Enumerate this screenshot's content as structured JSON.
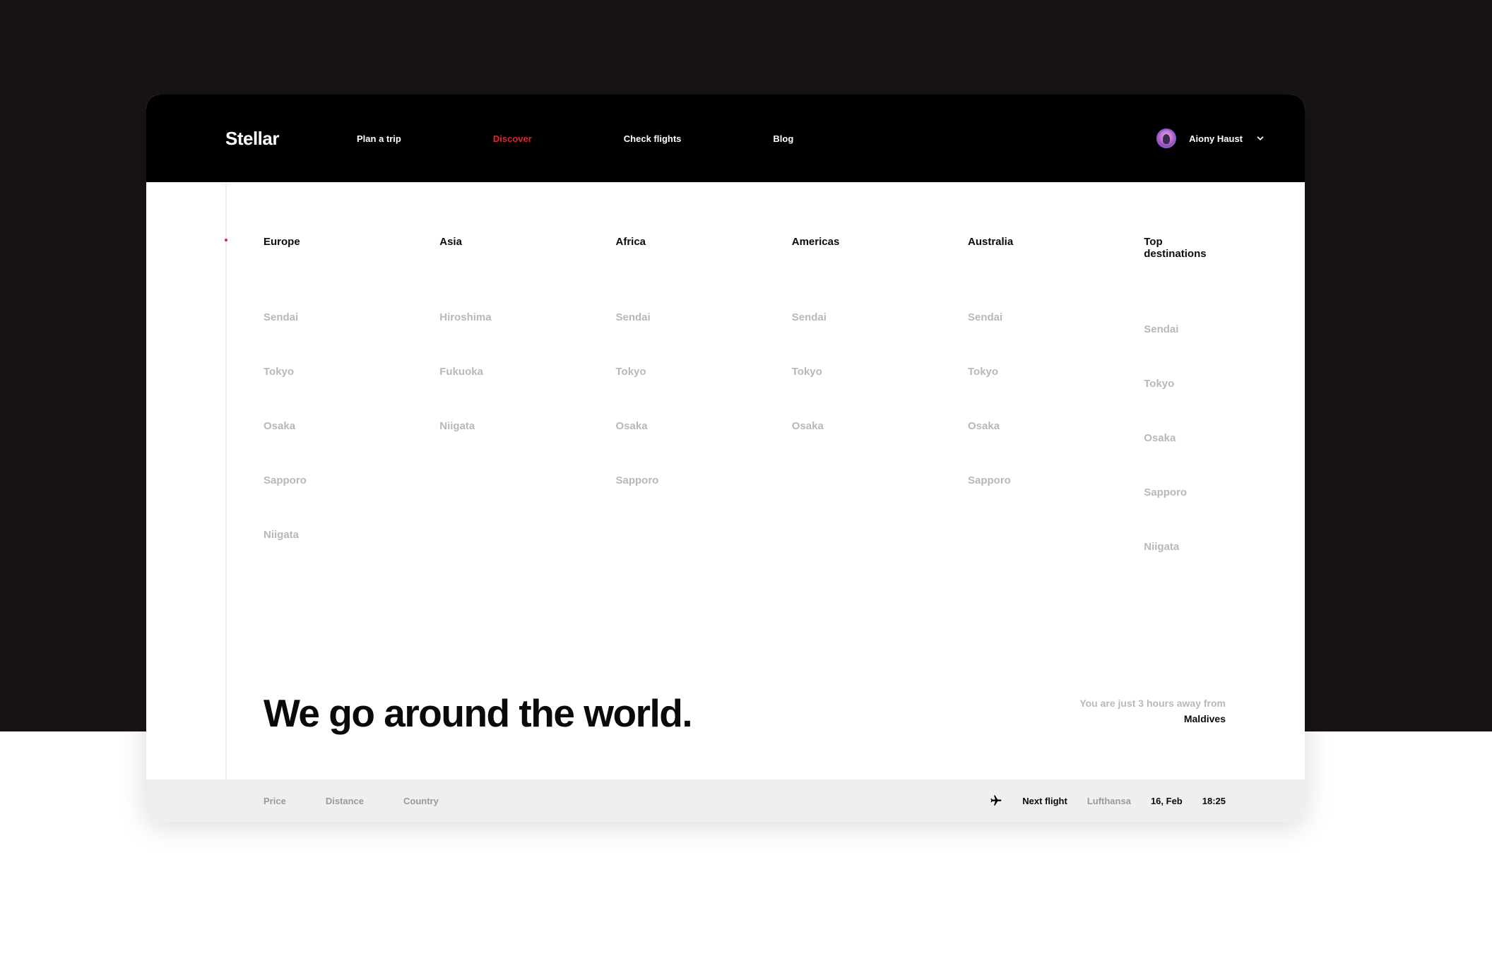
{
  "header": {
    "logo": "Stellar",
    "nav": [
      {
        "label": "Plan a trip",
        "active": false
      },
      {
        "label": "Discover",
        "active": true
      },
      {
        "label": "Check flights",
        "active": false
      },
      {
        "label": "Blog",
        "active": false
      }
    ],
    "user": {
      "name": "Aiony Haust"
    }
  },
  "columns": [
    {
      "heading": "Europe",
      "items": [
        "Sendai",
        "Tokyo",
        "Osaka",
        "Sapporo",
        "Niigata"
      ]
    },
    {
      "heading": "Asia",
      "items": [
        "Hiroshima",
        "Fukuoka",
        "Niigata"
      ]
    },
    {
      "heading": "Africa",
      "items": [
        "Sendai",
        "Tokyo",
        "Osaka",
        "Sapporo"
      ]
    },
    {
      "heading": "Americas",
      "items": [
        "Sendai",
        "Tokyo",
        "Osaka"
      ]
    },
    {
      "heading": "Australia",
      "items": [
        "Sendai",
        "Tokyo",
        "Osaka",
        "Sapporo"
      ]
    },
    {
      "heading": "Top destinations",
      "items": [
        "Sendai",
        "Tokyo",
        "Osaka",
        "Sapporo",
        "Niigata"
      ]
    }
  ],
  "hero": {
    "title": "We go around the world.",
    "subtitle": "You are just 3 hours away from",
    "destination": "Maldives"
  },
  "footer": {
    "sort": [
      "Price",
      "Distance",
      "Country"
    ],
    "next_flight": {
      "label": "Next flight",
      "airline": "Lufthansa",
      "date": "16, Feb",
      "time": "18:25"
    }
  }
}
